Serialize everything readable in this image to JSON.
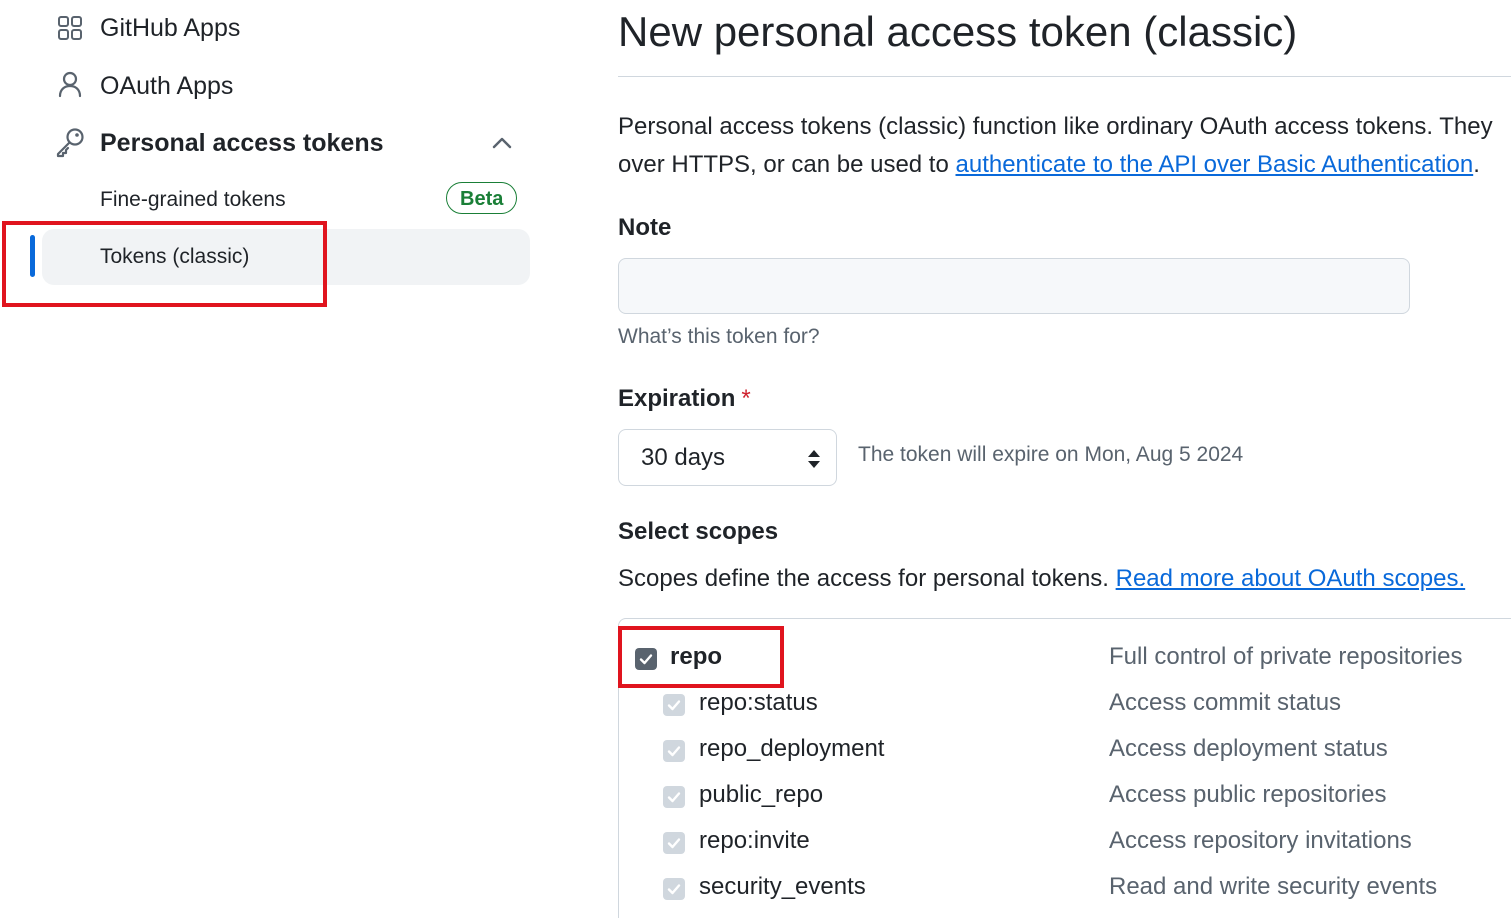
{
  "sidebar": {
    "items": [
      {
        "label": "GitHub Apps",
        "icon": "apps-grid-icon"
      },
      {
        "label": "OAuth Apps",
        "icon": "person-icon"
      },
      {
        "label": "Personal access tokens",
        "icon": "key-icon",
        "expanded": true
      }
    ],
    "sub_items": [
      {
        "label": "Fine-grained tokens",
        "badge": "Beta"
      },
      {
        "label": "Tokens (classic)",
        "active": true
      }
    ]
  },
  "main": {
    "title": "New personal access token (classic)",
    "description_line1": "Personal access tokens (classic) function like ordinary OAuth access tokens. They",
    "description_line2_prefix": "over HTTPS, or can be used to ",
    "description_link": "authenticate to the API over Basic Authentication",
    "description_line2_suffix": ".",
    "note": {
      "label": "Note",
      "value": "",
      "hint": "What’s this token for?"
    },
    "expiration": {
      "label": "Expiration",
      "required_mark": "*",
      "value": "30 days",
      "note": "The token will expire on Mon, Aug 5 2024"
    },
    "scopes": {
      "label": "Select scopes",
      "description": "Scopes define the access for personal tokens. ",
      "link": "Read more about OAuth scopes.",
      "rows": [
        {
          "name": "repo",
          "description": "Full control of private repositories",
          "checked": true,
          "bold": true
        },
        {
          "name": "repo:status",
          "description": "Access commit status",
          "checked": true
        },
        {
          "name": "repo_deployment",
          "description": "Access deployment status",
          "checked": true
        },
        {
          "name": "public_repo",
          "description": "Access public repositories",
          "checked": true
        },
        {
          "name": "repo:invite",
          "description": "Access repository invitations",
          "checked": true
        },
        {
          "name": "security_events",
          "description": "Read and write security events",
          "checked": true
        }
      ]
    }
  },
  "colors": {
    "accent": "#0969da",
    "success": "#1a7f37",
    "danger": "#cf222e",
    "highlight_box": "#e0141e"
  }
}
